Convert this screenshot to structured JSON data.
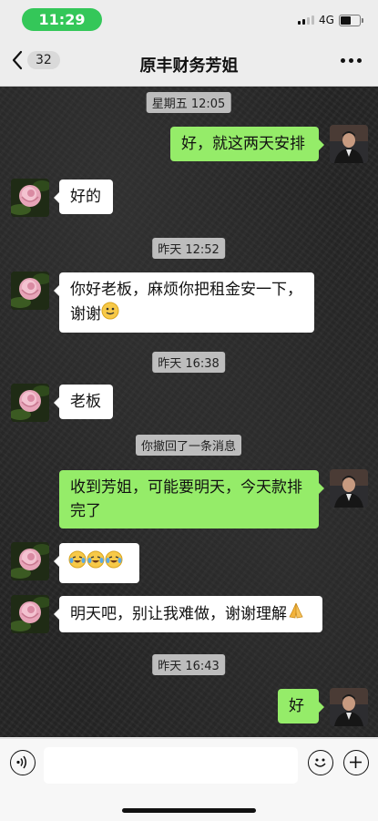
{
  "status": {
    "time": "11:29",
    "network": "4G",
    "battery_level": 0.6,
    "signal_bars": 2
  },
  "nav": {
    "back_count": "32",
    "title": "原丰财务芳姐"
  },
  "timestamps": [
    "星期五 12:05",
    "昨天 12:52",
    "昨天 16:38",
    "你撤回了一条消息",
    "昨天 16:43"
  ],
  "messages": [
    {
      "side": "out",
      "text": "好，就这两天安排"
    },
    {
      "side": "in",
      "text": "好的"
    },
    {
      "side": "in",
      "text": "你好老板，麻烦你把租金安一下，谢谢",
      "emoji": "smile-emoji"
    },
    {
      "side": "in",
      "text": "老板"
    },
    {
      "side": "out",
      "text": "收到芳姐，可能要明天，今天款排完了"
    },
    {
      "side": "in",
      "text": "",
      "emoji": "laugh-cry-emoji x3"
    },
    {
      "side": "in",
      "text": "明天吧，别让我难做，谢谢理解",
      "emoji": "pray-hands-emoji"
    },
    {
      "side": "out",
      "text": "好"
    }
  ],
  "input": {
    "placeholder": ""
  },
  "icons": {
    "voice": "voice-icon",
    "emoji": "emoji-face-icon",
    "plus": "plus-icon",
    "back": "chevron-left-icon",
    "more": "more-dots-icon"
  },
  "colors": {
    "out_bubble": "#95ec69",
    "in_bubble": "#ffffff",
    "status_pill": "#34c759",
    "chat_bg": "#262626"
  }
}
